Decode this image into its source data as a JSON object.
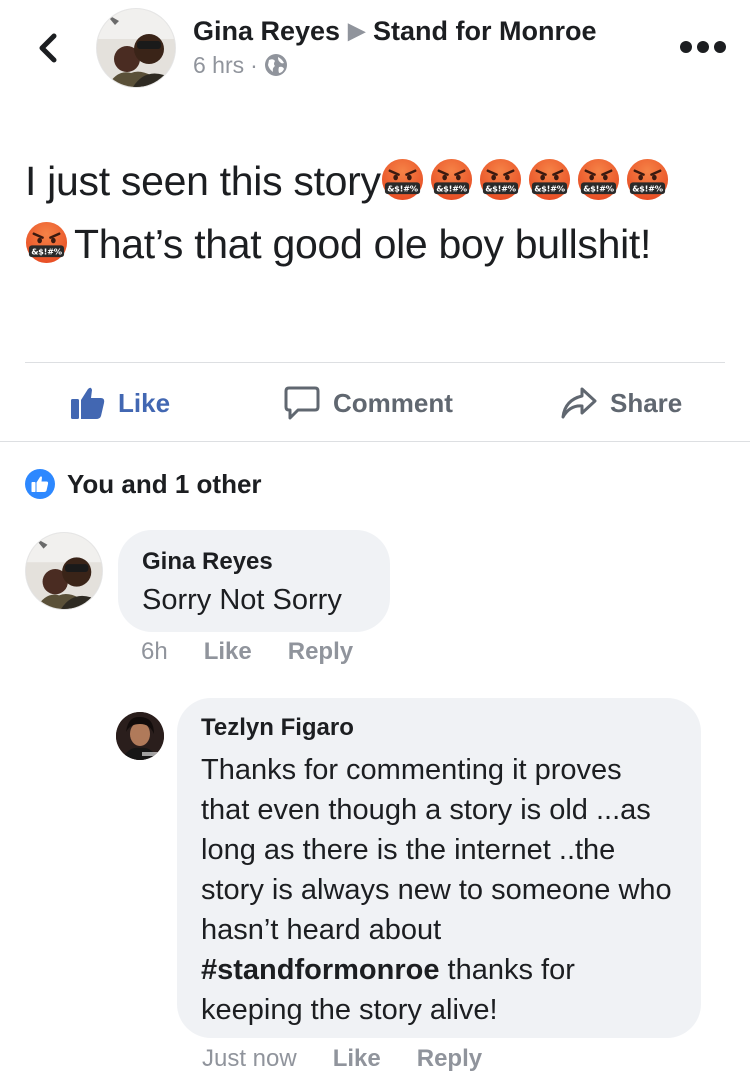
{
  "header": {
    "author": "Gina Reyes",
    "separator": "▶",
    "group": "Stand for Monroe",
    "time": "6 hrs",
    "dot": "·",
    "privacy_icon": "globe-icon",
    "back_icon": "chevron-left-icon",
    "more_icon": "more-dots-icon"
  },
  "post": {
    "text_part1": "I just seen this story",
    "emoji_name": "face-with-symbols-on-mouth",
    "emoji_label": "&$!#%",
    "text_part2": "That’s that good ole boy bullshit!"
  },
  "actions": {
    "like": "Like",
    "comment": "Comment",
    "share": "Share"
  },
  "reactions": {
    "summary": "You and 1 other"
  },
  "comments": [
    {
      "author": "Gina Reyes",
      "text": "Sorry Not Sorry",
      "time": "6h",
      "like": "Like",
      "reply": "Reply"
    },
    {
      "author": "Tezlyn Figaro",
      "text_before": "Thanks for commenting it proves that even though a story is old ...as long as there is the internet ..the story is always new to someone who hasn’t heard about ",
      "hashtag": "#standformonroe",
      "text_after": " thanks for keeping the story alive!",
      "time": "Just now",
      "like": "Like",
      "reply": "Reply"
    }
  ],
  "colors": {
    "accent": "#4267b2",
    "muted": "#90949c",
    "bubble": "#f0f2f5",
    "emoji": "#f05a28"
  }
}
